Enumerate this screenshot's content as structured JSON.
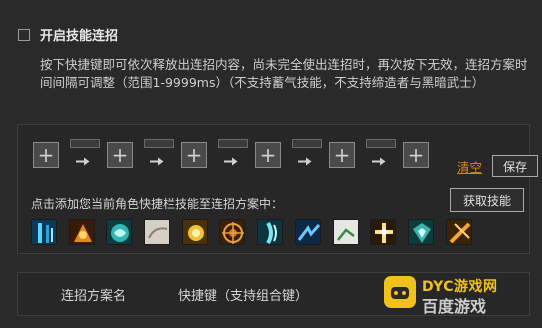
{
  "enable": {
    "label": "开启技能连招",
    "checked": false
  },
  "description": "按下快捷键即可依次释放出连招内容，尚未完全使出连招时，再次按下无效，连招方案时间间隔可调整（范围1-9999ms）（不支持蓄气技能，不支持缔造者与黑暗武士）",
  "combo": {
    "slot_glyph": "+",
    "slot_count": 6,
    "clear_label": "清空",
    "save_label": "保存"
  },
  "skills": {
    "hint": "点击添加您当前角色快捷栏技能至连招方案中：",
    "fetch_label": "获取技能",
    "icons": [
      "skill-icon-1",
      "skill-icon-2",
      "skill-icon-3",
      "skill-icon-4",
      "skill-icon-5",
      "skill-icon-6",
      "skill-icon-7",
      "skill-icon-8",
      "skill-icon-9",
      "skill-icon-10",
      "skill-icon-11",
      "skill-icon-12"
    ]
  },
  "table_headers": {
    "name": "连招方案名",
    "hotkey": "快捷键（支持组合键）"
  },
  "watermark": {
    "line1": "DYC游戏网",
    "line2": "百度游戏"
  },
  "colors": {
    "accent_orange": "#d9891e",
    "panel_bg": "#2a2a2a",
    "watermark_yellow": "#f1c21b"
  }
}
